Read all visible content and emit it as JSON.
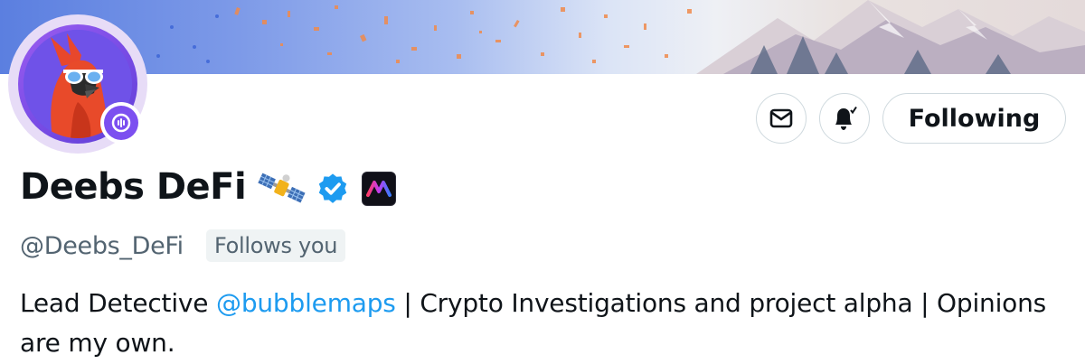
{
  "profile": {
    "display_name": "Deebs DeFi",
    "handle": "@Deebs_DeFi",
    "follows_you": "Follows you",
    "verified": true,
    "name_emoji": "satellite-emoji",
    "affiliate_badge": "affiliate-logo"
  },
  "bio": {
    "prefix": "Lead Detective ",
    "mention": "@bubblemaps",
    "suffix": " | Crypto Investigations and project alpha | Opinions are my own."
  },
  "actions": {
    "message_icon": "mail-icon",
    "notify_icon": "bell-check-icon",
    "follow_label": "Following"
  },
  "colors": {
    "verified": "#1d9bf0",
    "link": "#1d9bf0",
    "secondary_text": "#536471",
    "border": "#cfd9de",
    "spaces_badge": "#7c4ff0"
  }
}
